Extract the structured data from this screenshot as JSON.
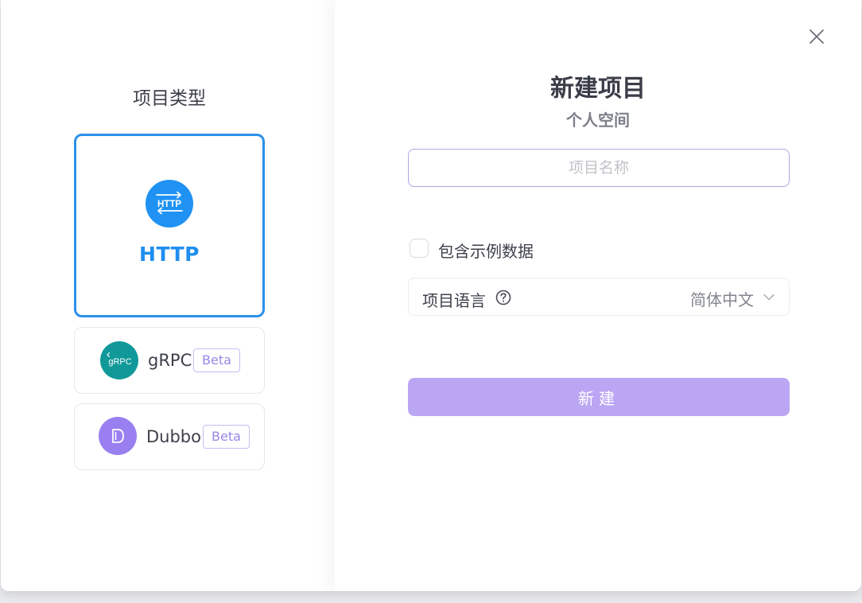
{
  "left_panel": {
    "title": "项目类型",
    "types": [
      {
        "id": "http",
        "label": "HTTP",
        "icon": "http-arrows-icon",
        "icon_text": "HTTP",
        "color": "#1f92f4",
        "selected": true
      },
      {
        "id": "grpc",
        "label": "gRPC",
        "icon": "grpc-logo-icon",
        "icon_text": "gRPC",
        "color": "#11999a",
        "badge": "Beta"
      },
      {
        "id": "dubbo",
        "label": "Dubbo",
        "icon": "dubbo-logo-icon",
        "color": "#9a7ff0",
        "badge": "Beta"
      }
    ]
  },
  "form": {
    "title": "新建项目",
    "subtitle": "个人空间",
    "name_input": {
      "placeholder": "项目名称",
      "value": ""
    },
    "include_sample_data": {
      "label": "包含示例数据",
      "checked": false
    },
    "language": {
      "label": "项目语言",
      "value": "简体中文",
      "help_icon": "question-circle-icon",
      "dropdown_icon": "chevron-down-icon"
    },
    "create_button": "新建"
  },
  "colors": {
    "accent_blue": "#2b90ea",
    "button_purple": "#bba6f3",
    "beta_purple": "#9a86e8"
  }
}
